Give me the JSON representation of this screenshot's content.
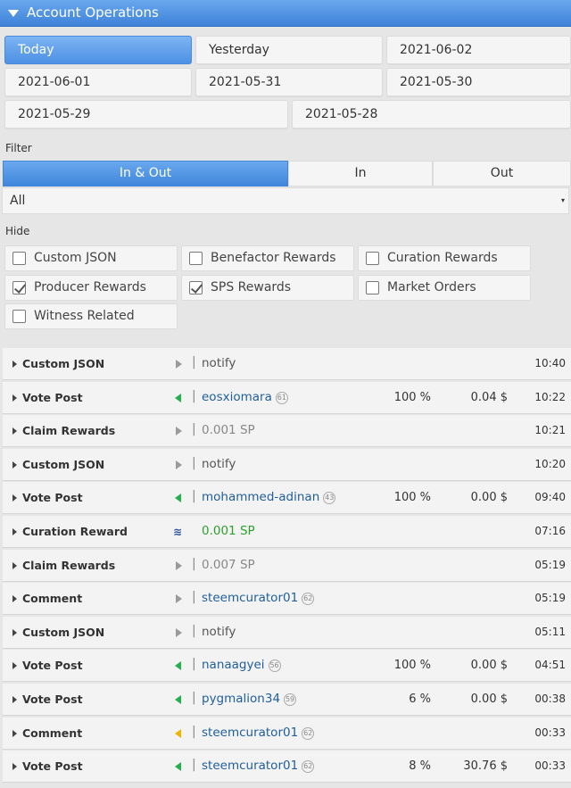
{
  "header": {
    "title": "Account Operations"
  },
  "dates": {
    "row1": [
      "Today",
      "Yesterday",
      "2021-06-02"
    ],
    "row2": [
      "2021-06-01",
      "2021-05-31",
      "2021-05-30"
    ],
    "row3": [
      "2021-05-29",
      "2021-05-28"
    ]
  },
  "filter": {
    "label": "Filter",
    "segments": [
      "In & Out",
      "In",
      "Out"
    ],
    "select_value": "All"
  },
  "hide": {
    "label": "Hide",
    "options": [
      {
        "label": "Custom JSON",
        "checked": false
      },
      {
        "label": "Benefactor Rewards",
        "checked": false
      },
      {
        "label": "Curation Rewards",
        "checked": false
      },
      {
        "label": "Producer Rewards",
        "checked": true
      },
      {
        "label": "SPS Rewards",
        "checked": true
      },
      {
        "label": "Market Orders",
        "checked": false
      },
      {
        "label": "Witness Related",
        "checked": false
      }
    ]
  },
  "colors": {
    "in": "#22b14c",
    "out": "#f0b400",
    "neutral": "#9a9a9a",
    "accent": "#4d90e4"
  },
  "operations": [
    {
      "type": "Custom JSON",
      "direction": "neutral",
      "desc": "notify",
      "desc_style": "plain",
      "rep": "",
      "pct": "",
      "amount": "",
      "time": "10:40"
    },
    {
      "type": "Vote Post",
      "direction": "in",
      "desc": "eosxiomara",
      "desc_style": "link",
      "rep": "61",
      "pct": "100 %",
      "amount": "0.04 $",
      "time": "10:22"
    },
    {
      "type": "Claim Rewards",
      "direction": "neutral",
      "desc": "0.001 SP",
      "desc_style": "gray",
      "rep": "",
      "pct": "",
      "amount": "",
      "time": "10:21"
    },
    {
      "type": "Custom JSON",
      "direction": "neutral",
      "desc": "notify",
      "desc_style": "plain",
      "rep": "",
      "pct": "",
      "amount": "",
      "time": "10:20"
    },
    {
      "type": "Vote Post",
      "direction": "in",
      "desc": "mohammed-adinan",
      "desc_style": "link",
      "rep": "43",
      "pct": "100 %",
      "amount": "0.00 $",
      "time": "09:40"
    },
    {
      "type": "Curation Reward",
      "direction": "steem",
      "desc": "0.001 SP",
      "desc_style": "green",
      "rep": "",
      "pct": "",
      "amount": "",
      "time": "07:16"
    },
    {
      "type": "Claim Rewards",
      "direction": "neutral",
      "desc": "0.007 SP",
      "desc_style": "gray",
      "rep": "",
      "pct": "",
      "amount": "",
      "time": "05:19"
    },
    {
      "type": "Comment",
      "direction": "neutral",
      "desc": "steemcurator01",
      "desc_style": "link",
      "rep": "62",
      "pct": "",
      "amount": "",
      "time": "05:19"
    },
    {
      "type": "Custom JSON",
      "direction": "neutral",
      "desc": "notify",
      "desc_style": "plain",
      "rep": "",
      "pct": "",
      "amount": "",
      "time": "05:11"
    },
    {
      "type": "Vote Post",
      "direction": "in",
      "desc": "nanaagyei",
      "desc_style": "link",
      "rep": "56",
      "pct": "100 %",
      "amount": "0.00 $",
      "time": "04:51"
    },
    {
      "type": "Vote Post",
      "direction": "in",
      "desc": "pygmalion34",
      "desc_style": "link",
      "rep": "59",
      "pct": "6 %",
      "amount": "0.00 $",
      "time": "00:38"
    },
    {
      "type": "Comment",
      "direction": "out",
      "desc": "steemcurator01",
      "desc_style": "link",
      "rep": "62",
      "pct": "",
      "amount": "",
      "time": "00:33"
    },
    {
      "type": "Vote Post",
      "direction": "in",
      "desc": "steemcurator01",
      "desc_style": "link",
      "rep": "62",
      "pct": "8 %",
      "amount": "30.76 $",
      "time": "00:33"
    }
  ]
}
